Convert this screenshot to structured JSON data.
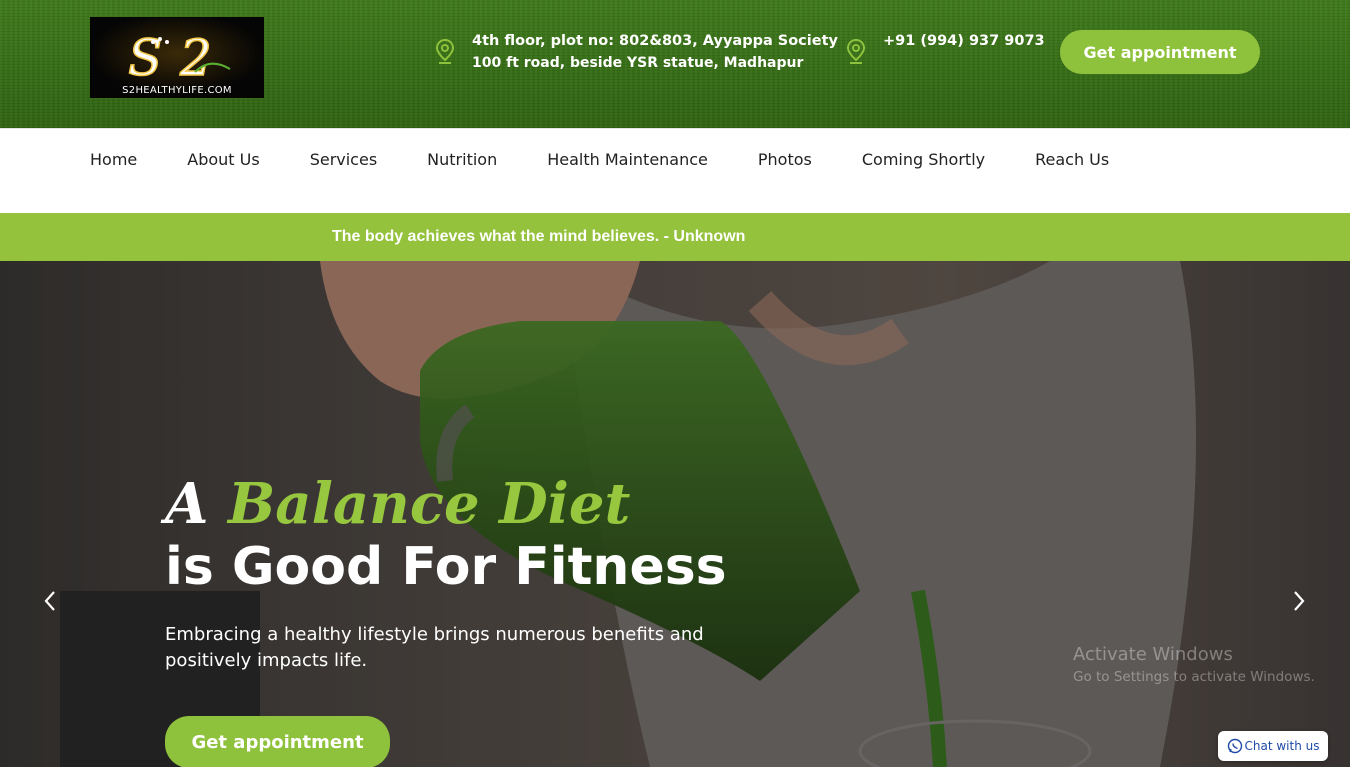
{
  "header": {
    "logo_text": "S2HEALTHYLIFE.COM",
    "logo_mark": "S2",
    "address_line1": "4th floor, plot no: 802&803, Ayyappa Society",
    "address_line2": "100 ft road, beside YSR statue, Madhapur",
    "phone": "+91 (994) 937 9073",
    "appointment_label": "Get appointment"
  },
  "nav": {
    "items": [
      {
        "label": "Home"
      },
      {
        "label": "About Us"
      },
      {
        "label": "Services"
      },
      {
        "label": "Nutrition"
      },
      {
        "label": "Health Maintenance"
      },
      {
        "label": "Photos"
      },
      {
        "label": "Coming Shortly"
      },
      {
        "label": "Reach Us"
      }
    ]
  },
  "quote": {
    "text": "The body achieves what the mind believes. - Unknown"
  },
  "hero": {
    "title_prefix": "A",
    "title_accent": "Balance Diet",
    "title_line2": "is Good For Fitness",
    "description": "Embracing a healthy lifestyle brings numerous benefits and positively impacts life.",
    "appointment_label": "Get appointment",
    "prev_icon": "chevron-left-icon",
    "next_icon": "chevron-right-icon"
  },
  "watermark": {
    "line1": "Activate Windows",
    "line2": "Go to Settings to activate Windows."
  },
  "chat": {
    "label": "Chat with us",
    "icon": "whatsapp-icon"
  },
  "colors": {
    "header_green": "#356d15",
    "accent_green": "#8fc23c",
    "quote_bar": "#95c23d"
  }
}
